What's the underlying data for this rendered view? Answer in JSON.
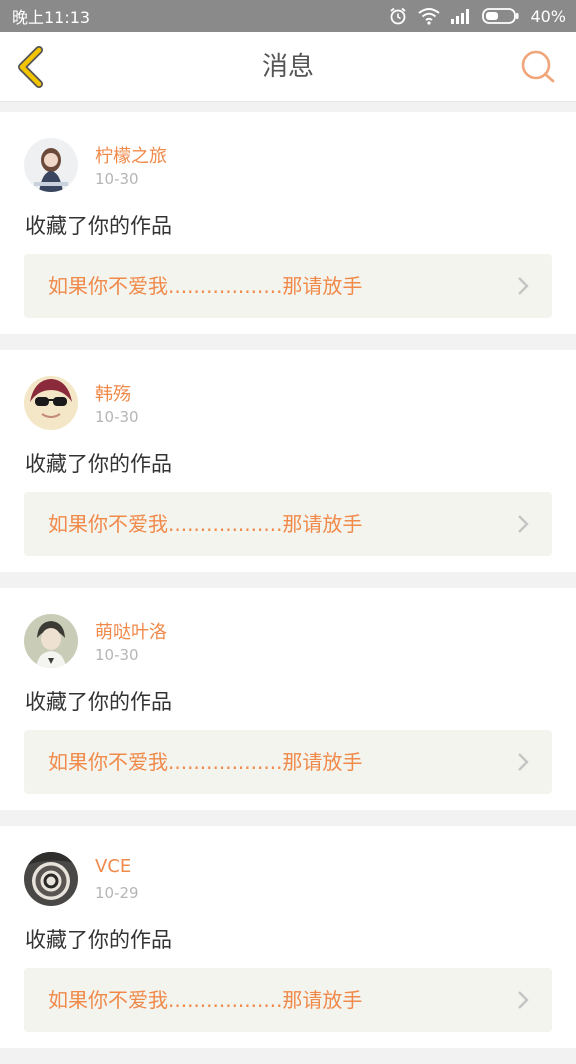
{
  "status_bar": {
    "time": "晚上11:13",
    "battery": "40%",
    "icons": [
      "alarm-icon",
      "wifi-icon",
      "signal-icon",
      "battery-icon"
    ]
  },
  "header": {
    "title": "消息",
    "back_icon": "chevron-left-icon",
    "search_icon": "search-icon"
  },
  "colors": {
    "accent": "#f08a4b",
    "back_icon": "#f2c500",
    "status_bar": "#8a8a8a",
    "card_link_bg": "#f4f4ee"
  },
  "messages": [
    {
      "username": "柠檬之旅",
      "date": "10-30",
      "action": "收藏了你的作品",
      "work_title": "如果你不爱我..................那请放手"
    },
    {
      "username": "韩殇",
      "date": "10-30",
      "action": "收藏了你的作品",
      "work_title": "如果你不爱我..................那请放手"
    },
    {
      "username": "萌哒叶洛",
      "date": "10-30",
      "action": "收藏了你的作品",
      "work_title": "如果你不爱我..................那请放手"
    },
    {
      "username": "VCE",
      "date": "10-29",
      "action": "收藏了你的作品",
      "work_title": "如果你不爱我..................那请放手"
    }
  ]
}
